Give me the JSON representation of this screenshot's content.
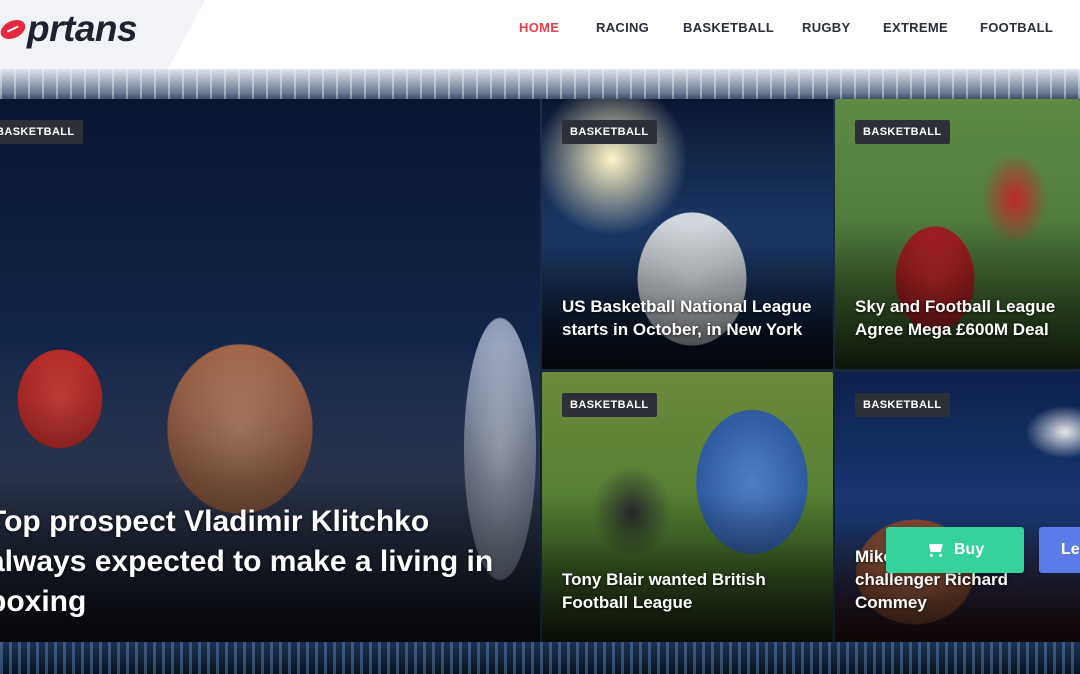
{
  "brand": {
    "logo_text_pre": "",
    "logo_text_post": "rtans",
    "logo_text_lead": "p"
  },
  "nav": {
    "items": [
      "HOME",
      "RACING",
      "BASKETBALL",
      "RUGBY",
      "EXTREME",
      "FOOTBALL"
    ],
    "active": "HOME"
  },
  "cards": {
    "main": {
      "badge": "BASKETBALL",
      "title": "Top prospect Vladimir Klitchko always expected to make a living in boxing"
    },
    "c1": {
      "badge": "BASKETBALL",
      "title": "US Basketball National League starts in October, in New York"
    },
    "c2": {
      "badge": "BASKETBALL",
      "title": "Sky and Football League Agree Mega £600M Deal"
    },
    "c3": {
      "badge": "BASKETBALL",
      "title": "Tony Blair wanted British Football League"
    },
    "c4": {
      "badge": "BASKETBALL",
      "title": "Mikey ... mandatory challenger Richard Commey"
    }
  },
  "actions": {
    "buy": "Buy",
    "learn": "Learn"
  },
  "colors": {
    "accent": "#e83f4b",
    "buy": "#35d29b",
    "learn": "#5b7be6"
  },
  "icons": {
    "cart": "cart-icon",
    "football": "football-icon"
  }
}
